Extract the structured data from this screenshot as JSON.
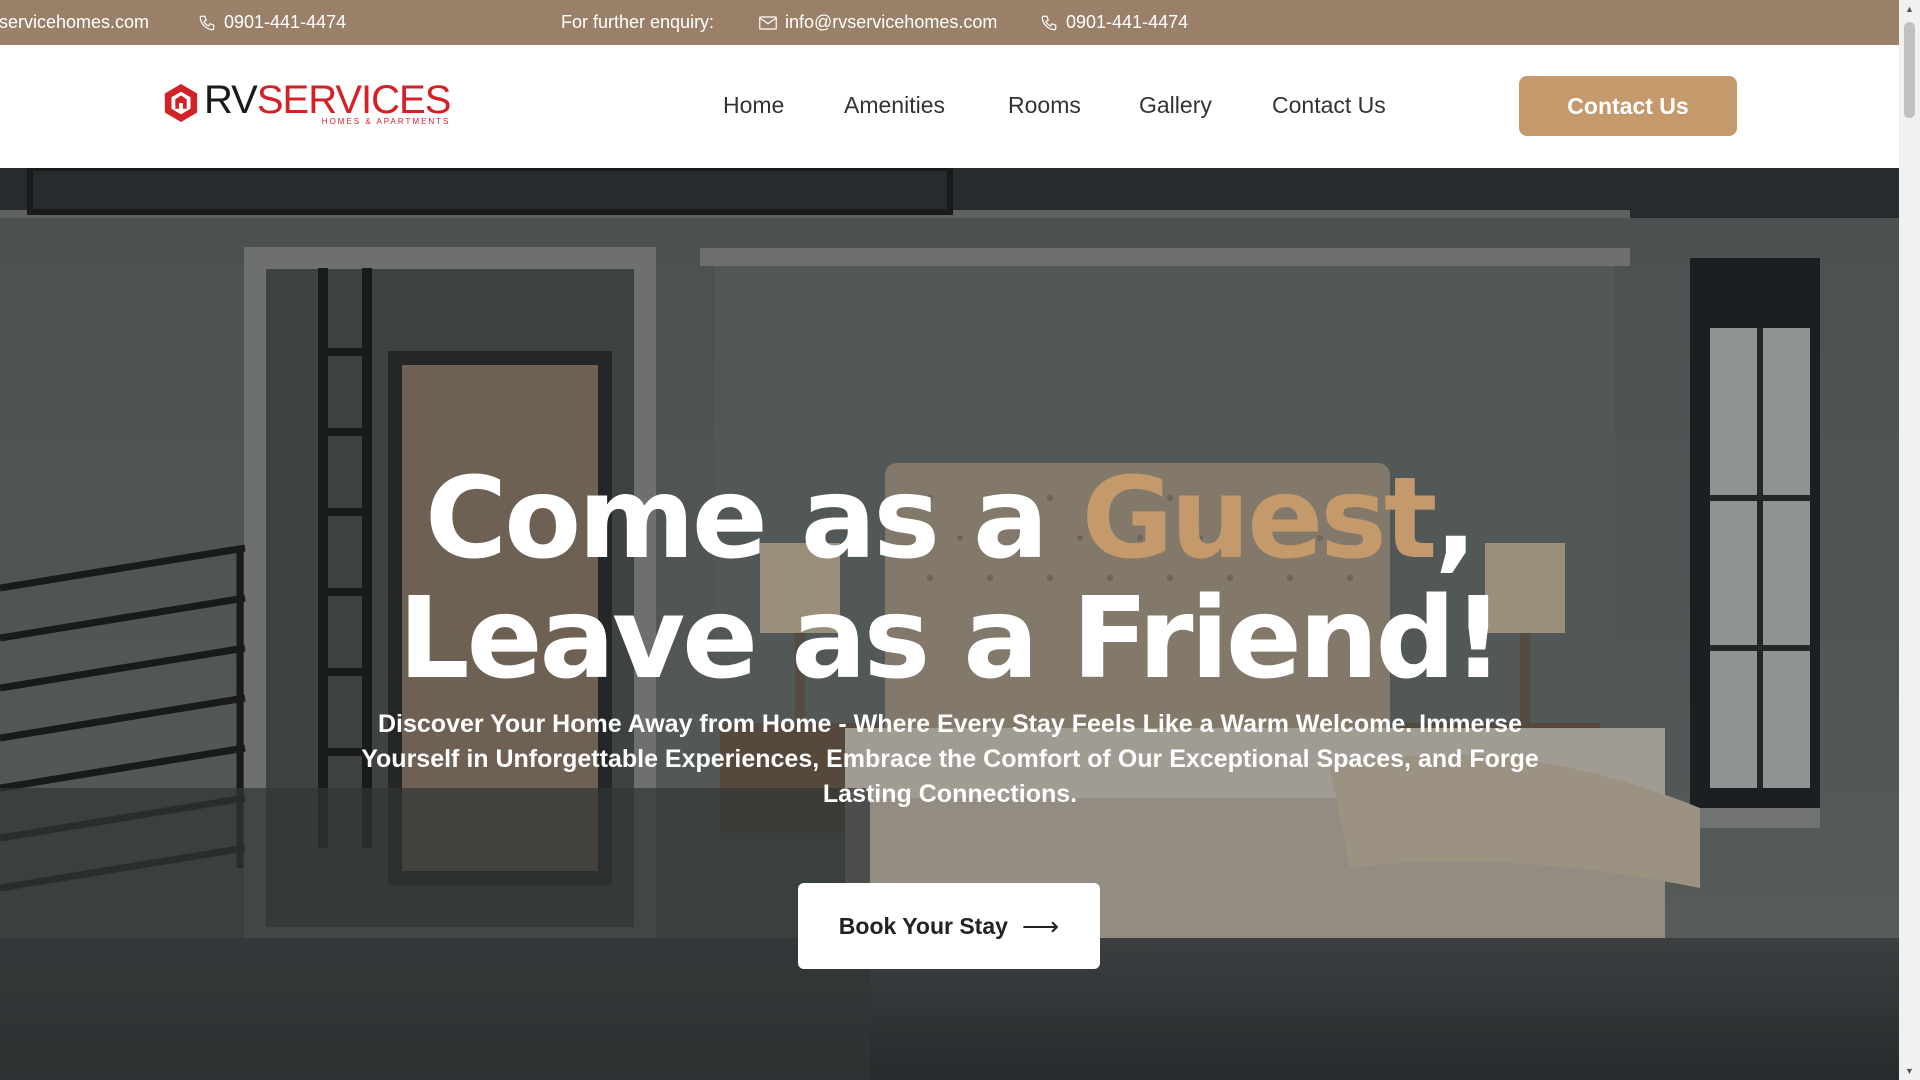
{
  "topbar": {
    "marquee_email": "vservicehomes.com",
    "marquee_phone": "0901-441-4474",
    "enquiry_label": "For further enquiry:",
    "email": "info@rvservicehomes.com",
    "phone": "0901-441-4474"
  },
  "logo": {
    "word_main": "RV",
    "word_accent": "SERVICES",
    "subtitle": "HOMES & APARTMENTS"
  },
  "nav": {
    "items": [
      {
        "label": "Home"
      },
      {
        "label": "Amenities"
      },
      {
        "label": "Rooms"
      },
      {
        "label": "Gallery"
      },
      {
        "label": "Contact Us"
      }
    ],
    "cta_label": "Contact Us"
  },
  "hero": {
    "line1_prefix": "Come as a ",
    "line1_accent": "Guest",
    "line1_suffix": ",",
    "line2": "Leave as a Friend!",
    "subtitle": "Discover Your Home Away from Home - Where Every Stay Feels Like a Warm Welcome. Immerse Yourself in Unforgettable Experiences, Embrace the Comfort of Our Exceptional Spaces, and Forge Lasting Connections.",
    "button_label": "Book Your Stay",
    "button_icon": "arrow-right-icon"
  },
  "colors": {
    "topbar_bg": "#9a8068",
    "accent": "#c49a6c",
    "logo_red": "#d42027"
  }
}
